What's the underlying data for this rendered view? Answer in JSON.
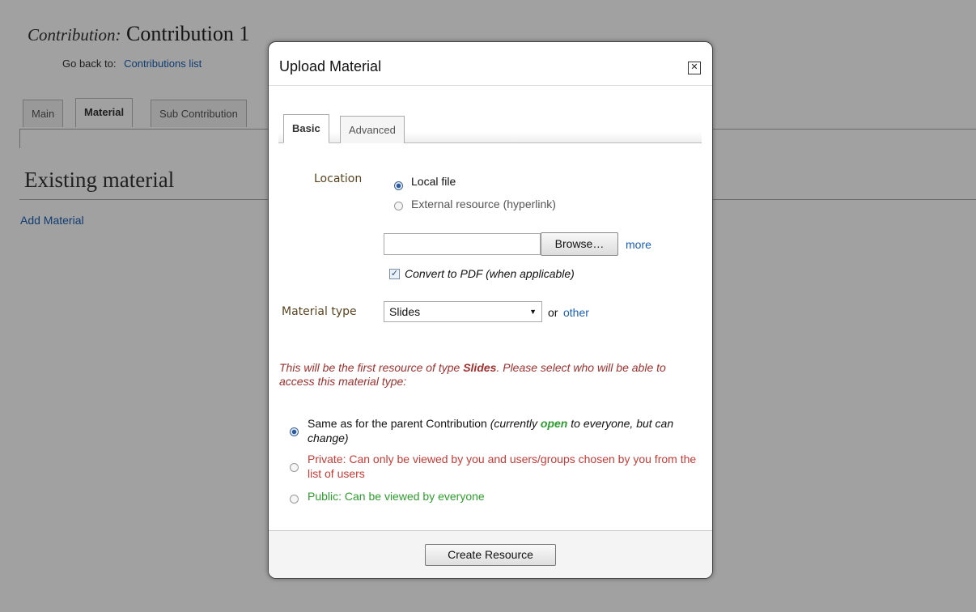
{
  "page": {
    "contribution_label": "Contribution:",
    "contribution_title": "Contribution 1",
    "go_back_label": "Go back to:",
    "go_back_link": "Contributions list",
    "tabs": [
      {
        "label": "Main"
      },
      {
        "label": "Material"
      },
      {
        "label": "Sub Contribution"
      }
    ],
    "section_title": "Existing material",
    "add_material": "Add Material"
  },
  "dialog": {
    "title": "Upload Material",
    "close_icon": "close-icon",
    "tabs": [
      {
        "label": "Basic"
      },
      {
        "label": "Advanced"
      }
    ],
    "location_label": "Location",
    "location_options": [
      {
        "label": "Local file",
        "selected": true
      },
      {
        "label": "External resource (hyperlink)",
        "selected": false
      }
    ],
    "file_input_value": "",
    "browse_label": "Browse…",
    "more_link": "more",
    "convert_pdf_label": "Convert to PDF (when applicable)",
    "convert_pdf_checked": true,
    "material_type_label": "Material type",
    "material_type_value": "Slides",
    "or_label": "or",
    "other_link": "other",
    "warning_prefix": "This will be the first resource of type ",
    "warning_type": "Slides",
    "warning_suffix": ". Please select who will be able to access this material type:",
    "access_options": {
      "same": {
        "main": "Same as for the parent Contribution",
        "note_prefix": "(currently ",
        "note_status": "open",
        "note_suffix": " to everyone, but can change)",
        "selected": true
      },
      "private": {
        "label": "Private: Can only be viewed by you and users/groups chosen by you from the list of users",
        "selected": false
      },
      "public": {
        "label": "Public: Can be viewed by everyone",
        "selected": false
      }
    },
    "create_button": "Create Resource"
  },
  "colors": {
    "link": "#1a5fb4",
    "warning": "#a0302e",
    "private": "#c93a36",
    "public": "#2e9d2e"
  }
}
